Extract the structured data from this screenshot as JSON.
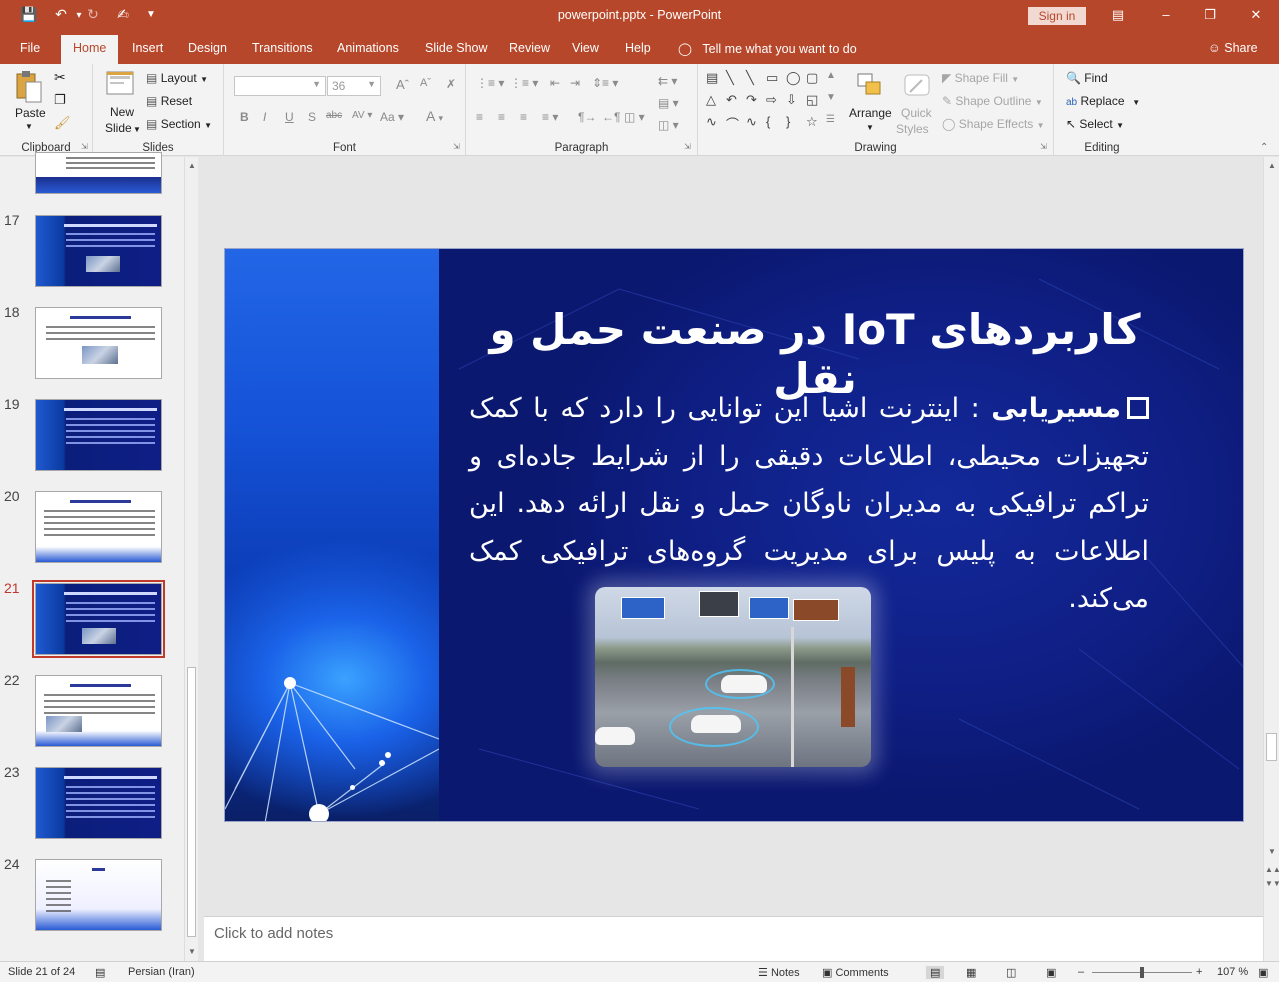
{
  "window": {
    "title": "powerpoint.pptx  -  PowerPoint",
    "sign_in": "Sign in",
    "quick_access": [
      "save-icon",
      "undo-icon",
      "redo-icon",
      "touch-mode-icon",
      "customize-icon"
    ]
  },
  "tabs": [
    "File",
    "Home",
    "Insert",
    "Design",
    "Transitions",
    "Animations",
    "Slide Show",
    "Review",
    "View",
    "Help"
  ],
  "active_tab": "Home",
  "tell_me": "Tell me what you want to do",
  "share": "Share",
  "ribbon": {
    "clipboard": {
      "label": "Clipboard",
      "paste": "Paste"
    },
    "slides": {
      "label": "Slides",
      "new_slide_1": "New",
      "new_slide_2": "Slide",
      "layout": "Layout",
      "reset": "Reset",
      "section": "Section"
    },
    "font": {
      "label": "Font",
      "size": "36"
    },
    "paragraph": {
      "label": "Paragraph"
    },
    "drawing": {
      "label": "Drawing",
      "arrange": "Arrange",
      "quick_1": "Quick",
      "quick_2": "Styles",
      "shape_fill": "Shape Fill",
      "shape_outline": "Shape Outline",
      "shape_effects": "Shape Effects"
    },
    "editing": {
      "label": "Editing",
      "find": "Find",
      "replace": "Replace",
      "select": "Select"
    }
  },
  "thumbnails": [
    "17",
    "18",
    "19",
    "20",
    "21",
    "22",
    "23",
    "24"
  ],
  "current_slide": "21",
  "slide": {
    "title": "کاربردهای IoT در صنعت حمل و نقل",
    "bullet_keyword": "مسیریابی",
    "bullet_text": " : اینترنت اشیا این توانایی را دارد که با کمک تجهیزات محیطی، اطلاعات دقیقی را از شرایط جاده‌ای و تراکم ترافیکی به مدیران ناوگان حمل و نقل ارائه دهد. این اطلاعات به پلیس برای مدیریت گروه‌های ترافیکی کمک می‌کند."
  },
  "notes_placeholder": "Click to add notes",
  "status": {
    "slide_of": "Slide 21 of 24",
    "language": "Persian (Iran)",
    "notes": "Notes",
    "comments": "Comments",
    "zoom": "107 %"
  },
  "colors": {
    "accent": "#b7472a",
    "slide_bg": "#0d1b7c",
    "selected_thumb": "#c0392b"
  }
}
